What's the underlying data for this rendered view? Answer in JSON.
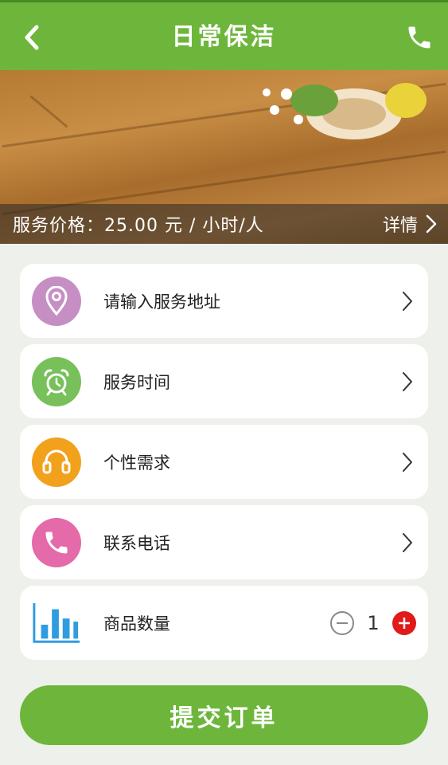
{
  "header": {
    "title": "日常保洁",
    "back_icon": "chevron-left-icon",
    "phone_icon": "phone-icon"
  },
  "banner": {
    "price_text": "服务价格：25.00 元 / 小时/人",
    "detail_label": "详情"
  },
  "rows": [
    {
      "label": "请输入服务地址",
      "icon": "location-pin-icon",
      "color": "#c58fc4"
    },
    {
      "label": "服务时间",
      "icon": "alarm-clock-icon",
      "color": "#77c05a"
    },
    {
      "label": "个性需求",
      "icon": "headset-icon",
      "color": "#f2a11c"
    },
    {
      "label": "联系电话",
      "icon": "phone-icon",
      "color": "#e46aa9"
    }
  ],
  "quantity": {
    "label": "商品数量",
    "value": "1",
    "icon": "bar-chart-icon",
    "icon_color": "#2f9be0",
    "minus_icon": "minus-circle-icon",
    "plus_icon": "plus-circle-icon",
    "plus_color": "#e01919"
  },
  "submit": {
    "label": "提交订单"
  },
  "colors": {
    "accent": "#6db63b",
    "background": "#eef0ec"
  }
}
